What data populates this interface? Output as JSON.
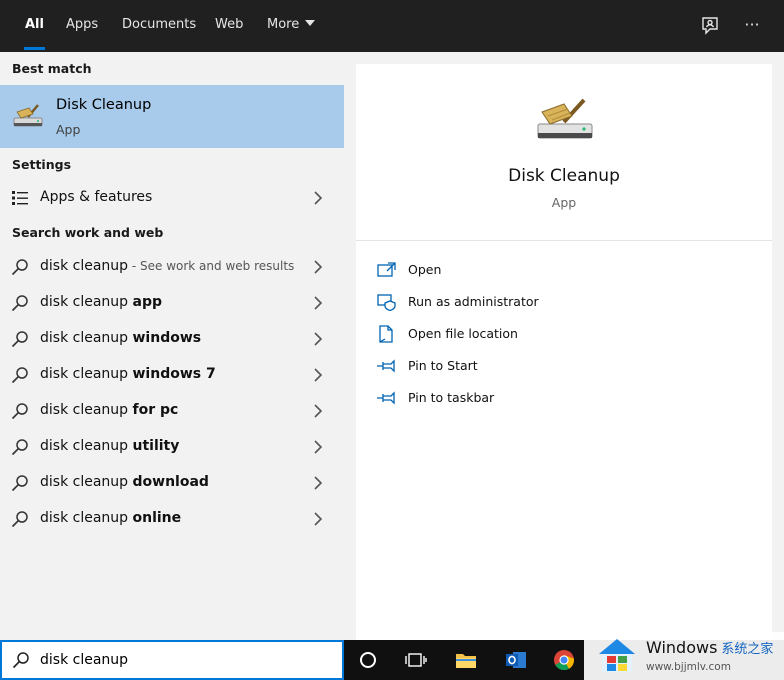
{
  "topbar": {
    "tabs": [
      {
        "label": "All",
        "active": true
      },
      {
        "label": "Apps",
        "active": false
      },
      {
        "label": "Documents",
        "active": false
      },
      {
        "label": "Web",
        "active": false
      },
      {
        "label": "More",
        "active": false
      }
    ],
    "icons": [
      "feedback-icon",
      "more-options-icon"
    ],
    "more_options_glyph": "···"
  },
  "left": {
    "best_match_label": "Best match",
    "best_match": {
      "title": "Disk Cleanup",
      "subtitle": "App",
      "icon": "disk-cleanup-icon"
    },
    "settings_label": "Settings",
    "settings_items": [
      {
        "label": "Apps & features",
        "icon": "apps-features-icon"
      }
    ],
    "web_label": "Search work and web",
    "web_items": [
      {
        "prefix": "disk cleanup",
        "bold": "",
        "hint": " - See work and web results"
      },
      {
        "prefix": "disk cleanup ",
        "bold": "app",
        "hint": ""
      },
      {
        "prefix": "disk cleanup ",
        "bold": "windows",
        "hint": ""
      },
      {
        "prefix": "disk cleanup ",
        "bold": "windows 7",
        "hint": ""
      },
      {
        "prefix": "disk cleanup ",
        "bold": "for pc",
        "hint": ""
      },
      {
        "prefix": "disk cleanup ",
        "bold": "utility",
        "hint": ""
      },
      {
        "prefix": "disk cleanup ",
        "bold": "download",
        "hint": ""
      },
      {
        "prefix": "disk cleanup ",
        "bold": "online",
        "hint": ""
      }
    ]
  },
  "right": {
    "title": "Disk Cleanup",
    "type": "App",
    "actions": [
      {
        "label": "Open",
        "icon": "open-icon"
      },
      {
        "label": "Run as administrator",
        "icon": "run-as-admin-icon"
      },
      {
        "label": "Open file location",
        "icon": "file-location-icon"
      },
      {
        "label": "Pin to Start",
        "icon": "pin-icon"
      },
      {
        "label": "Pin to taskbar",
        "icon": "pin-icon"
      }
    ]
  },
  "search": {
    "value": "disk cleanup",
    "icon": "search-icon"
  },
  "taskbar": {
    "icons": [
      "cortana-icon",
      "task-view-icon",
      "file-explorer-icon",
      "outlook-icon",
      "chrome-icon"
    ]
  },
  "watermark": {
    "title": "Windows",
    "subtitle": "系统之家",
    "url": "www.bjjmlv.com"
  },
  "colors": {
    "topbar": "#202020",
    "accent": "#0078d7",
    "selected_row": "#a8cbeb",
    "pane_bg": "#f2f2f2",
    "detail_bg": "#ffffff",
    "taskbar": "#101010"
  }
}
